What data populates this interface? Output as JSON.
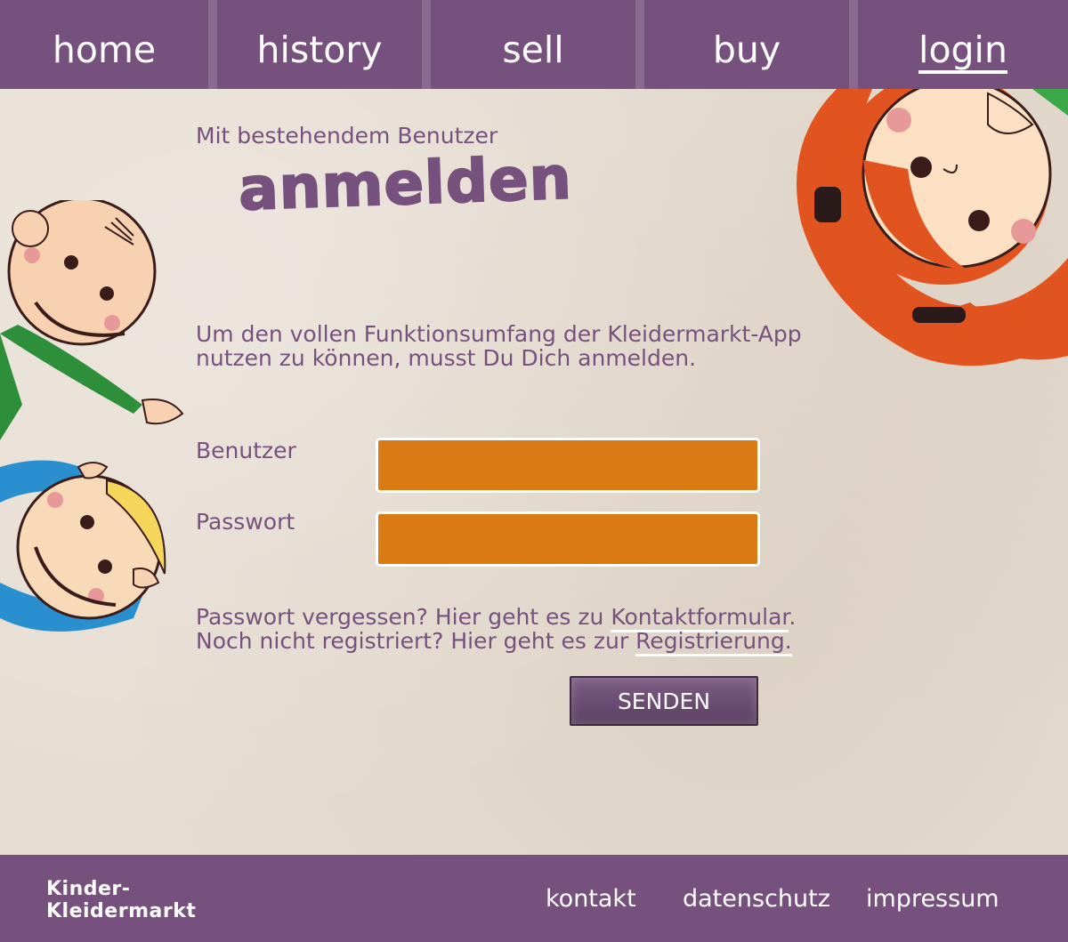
{
  "nav": {
    "items": [
      {
        "label": "home"
      },
      {
        "label": "history"
      },
      {
        "label": "sell"
      },
      {
        "label": "buy"
      },
      {
        "label": "login"
      }
    ],
    "active": "login"
  },
  "login": {
    "subtitle": "Mit bestehendem Benutzer",
    "title": "anmelden",
    "intro": "Um den vollen Funktionsumfang der Kleidermarkt-App nutzen zu können, musst Du Dich anmelden.",
    "user_label": "Benutzer",
    "user_value": "",
    "password_label": "Passwort",
    "password_value": "",
    "forgot_text": "Passwort vergessen? Hier geht es zu ",
    "contact_link": "Kontaktformular",
    "forgot_end": ".",
    "register_text": "Noch nicht registriert? Hier geht es zur ",
    "register_link": "Registrierung.",
    "submit_label": "SENDEN"
  },
  "footer": {
    "logo_line1": "Kinder-",
    "logo_line2": "Kleidermarkt",
    "links": [
      "kontakt",
      "datenschutz",
      "impressum"
    ]
  },
  "colors": {
    "primary": "#77517e",
    "input_bg": "#d97b12",
    "background": "#e6ddd2"
  }
}
